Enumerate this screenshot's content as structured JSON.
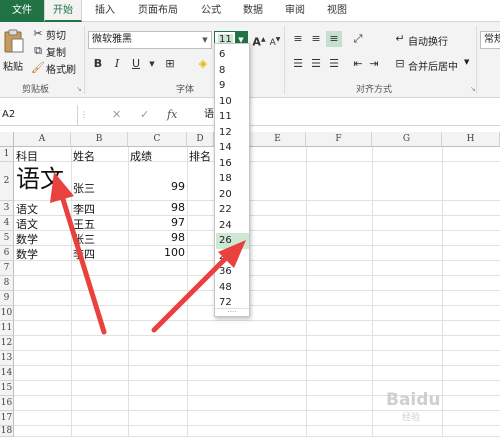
{
  "tabs": [
    "文件",
    "开始",
    "插入",
    "页面布局",
    "公式",
    "数据",
    "审阅",
    "视图"
  ],
  "ribbon": {
    "clipboard": {
      "paste": "粘贴",
      "cut": "剪切",
      "copy": "复制",
      "format_painter": "格式刷",
      "group": "剪贴板"
    },
    "font": {
      "font_name": "微软雅黑",
      "font_size": "11",
      "bold": "B",
      "italic": "I",
      "underline": "U",
      "group": "字体",
      "grow": "A",
      "shrink": "A"
    },
    "align": {
      "wrap": "自动换行",
      "merge": "合并后居中",
      "group": "对齐方式"
    },
    "number": {
      "format": "常规"
    }
  },
  "formula_bar": {
    "name_box": "A2",
    "fx": "fx",
    "value": "语"
  },
  "sheet": {
    "columns": [
      "A",
      "B",
      "C",
      "D",
      "E",
      "F",
      "G",
      "H"
    ],
    "rows": [
      "1",
      "2",
      "3",
      "4",
      "5",
      "6",
      "7",
      "8",
      "9",
      "10",
      "11",
      "12",
      "13",
      "14",
      "15",
      "16",
      "17",
      "18",
      "19"
    ],
    "cells": {
      "A1": "科目",
      "B1": "姓名",
      "C1": "成绩",
      "D1": "排名",
      "A2": "语文",
      "B2": "张三",
      "C2": "99",
      "A3": "语文",
      "B3": "李四",
      "C3": "98",
      "A4": "语文",
      "B4": "王五",
      "C4": "97",
      "A5": "数学",
      "B5": "张三",
      "C5": "98",
      "A6": "数学",
      "B6": "李四",
      "C6": "100"
    }
  },
  "font_size_dropdown": {
    "options": [
      "6",
      "8",
      "9",
      "10",
      "11",
      "12",
      "14",
      "16",
      "18",
      "20",
      "22",
      "24",
      "26",
      "28",
      "36",
      "48",
      "72"
    ],
    "highlighted": "26"
  },
  "watermark": {
    "logo": "Baidu",
    "sub": "经验"
  },
  "colors": {
    "accent": "#217346",
    "arrow": "#e8413e",
    "highlight": "#cfe8d6"
  }
}
